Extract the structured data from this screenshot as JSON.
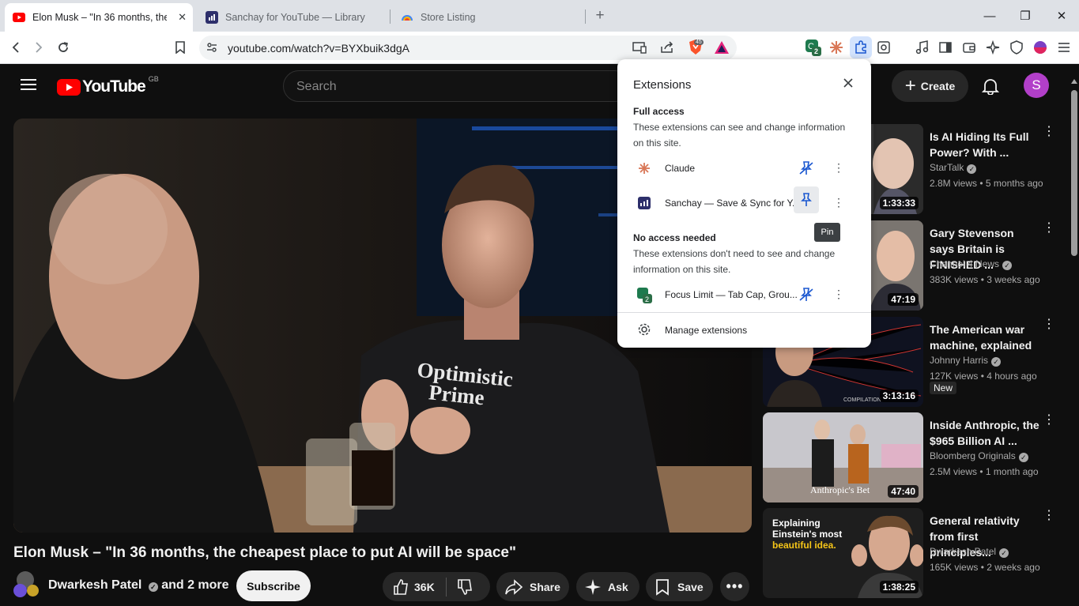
{
  "tabs": [
    {
      "title": "Elon Musk – \"In 36 months, the c",
      "active": true
    },
    {
      "title": "Sanchay for YouTube — Library",
      "active": false
    },
    {
      "title": "Store Listing",
      "active": false
    }
  ],
  "window": {
    "minimize": "—",
    "maximize": "❐",
    "close": "✕",
    "newtab": "+"
  },
  "omnibox": {
    "url": "youtube.com/watch?v=BYXbuik3dgA",
    "brave_count": "45",
    "focus_badge": "2"
  },
  "yt": {
    "logo_text": "YouTube",
    "region": "GB",
    "search_placeholder": "Search",
    "create_label": "Create",
    "avatar_letter": "S",
    "video_title": "Elon Musk – \"In 36 months, the cheapest place to put AI will be space\"",
    "shirt_line1": "Optimistic",
    "shirt_line2": "Prime",
    "channel": "Dwarkesh Patel",
    "channel_more": "and 2 more",
    "subscribe": "Subscribe",
    "likes": "36K",
    "share": "Share",
    "ask": "Ask",
    "save": "Save"
  },
  "recs": [
    {
      "title": "Is AI Hiding Its Full Power? With ...",
      "channel": "StarTalk",
      "meta": "2.8M views • 5 months ago",
      "duration": "1:33:33",
      "badge": ""
    },
    {
      "title": "Gary Stevenson says Britain is FINISHED ...",
      "channel": "Channel 4 News",
      "meta": "383K views • 3 weeks ago",
      "duration": "47:19",
      "badge": ""
    },
    {
      "title": "The American war machine, explained",
      "channel": "Johnny Harris",
      "meta": "127K views • 4 hours ago",
      "duration": "3:13:16",
      "badge": "New",
      "overlay": "COMPILATION"
    },
    {
      "title": "Inside Anthropic, the $965 Billion AI ...",
      "channel": "Bloomberg Originals",
      "meta": "2.5M views • 1 month ago",
      "duration": "47:40",
      "badge": "",
      "overlay": "Anthropic's Bet"
    },
    {
      "title": "General relativity from first principles...",
      "channel": "Dwarkesh Patel",
      "meta": "165K views • 2 weeks ago",
      "duration": "1:38:25",
      "badge": "",
      "overlay1": "Explaining",
      "overlay2": "Einstein's most",
      "overlay3": "beautiful idea."
    }
  ],
  "ext": {
    "title": "Extensions",
    "full_access": "Full access",
    "full_desc": "These extensions can see and change information on this site.",
    "no_access": "No access needed",
    "no_desc": "These extensions don't need to see and change information on this site.",
    "items": [
      {
        "name": "Claude"
      },
      {
        "name": "Sanchay — Save & Sync for Y..."
      },
      {
        "name": "Focus Limit — Tab Cap, Grou..."
      }
    ],
    "manage": "Manage extensions",
    "tooltip": "Pin"
  },
  "colors": {
    "yt_red": "#ff0000",
    "claude": "#d97757",
    "avatar": "#b23fc9"
  }
}
